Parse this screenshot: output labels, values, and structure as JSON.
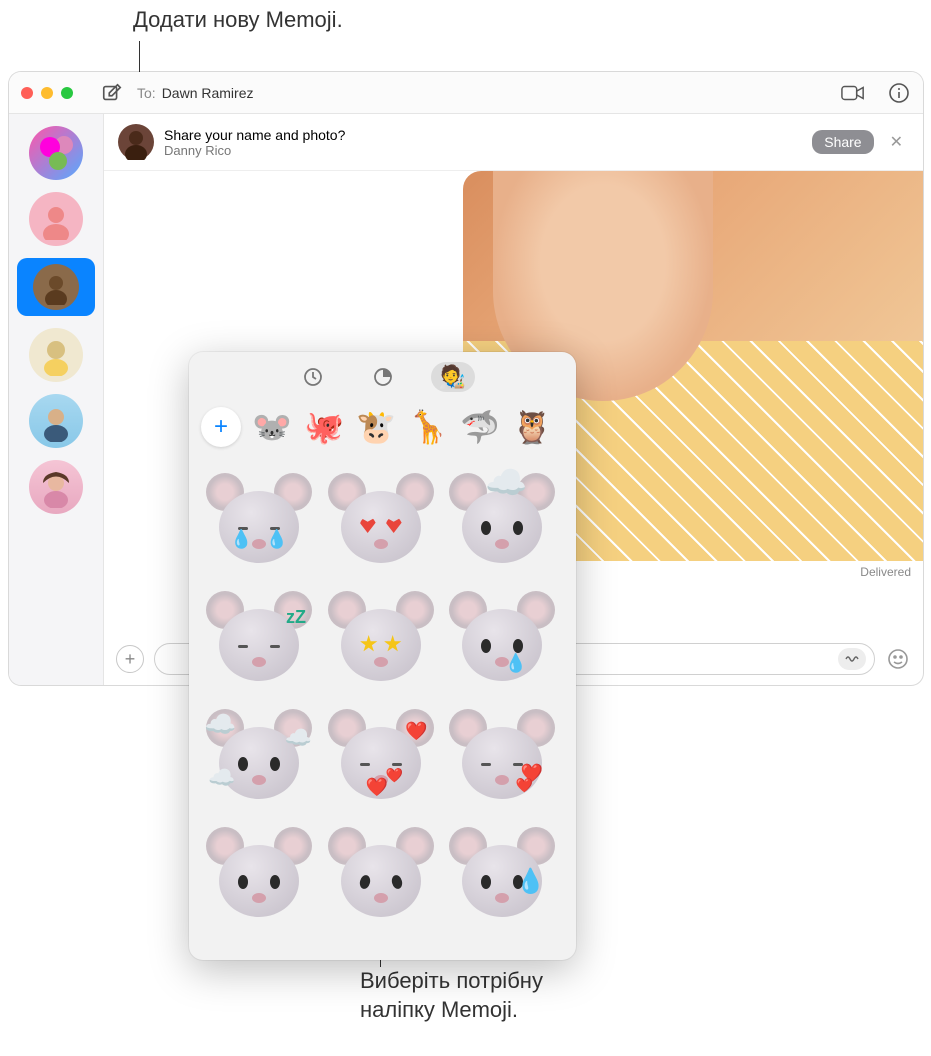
{
  "annotations": {
    "add_new": "Додати нову Memoji.",
    "choose_sticker": "Виберіть потрібну наліпку Memoji."
  },
  "titlebar": {
    "to_label": "To:",
    "to_value": "Dawn Ramirez"
  },
  "banner": {
    "title": "Share your name and photo?",
    "subtitle": "Danny Rico",
    "share_button": "Share"
  },
  "status": {
    "delivered": "Delivered"
  },
  "memoji": {
    "heads": [
      "mouse",
      "octopus",
      "cow",
      "giraffe",
      "shark",
      "owl"
    ]
  },
  "colors": {
    "accent": "#0a84ff",
    "banner_button": "#8e8e93"
  }
}
